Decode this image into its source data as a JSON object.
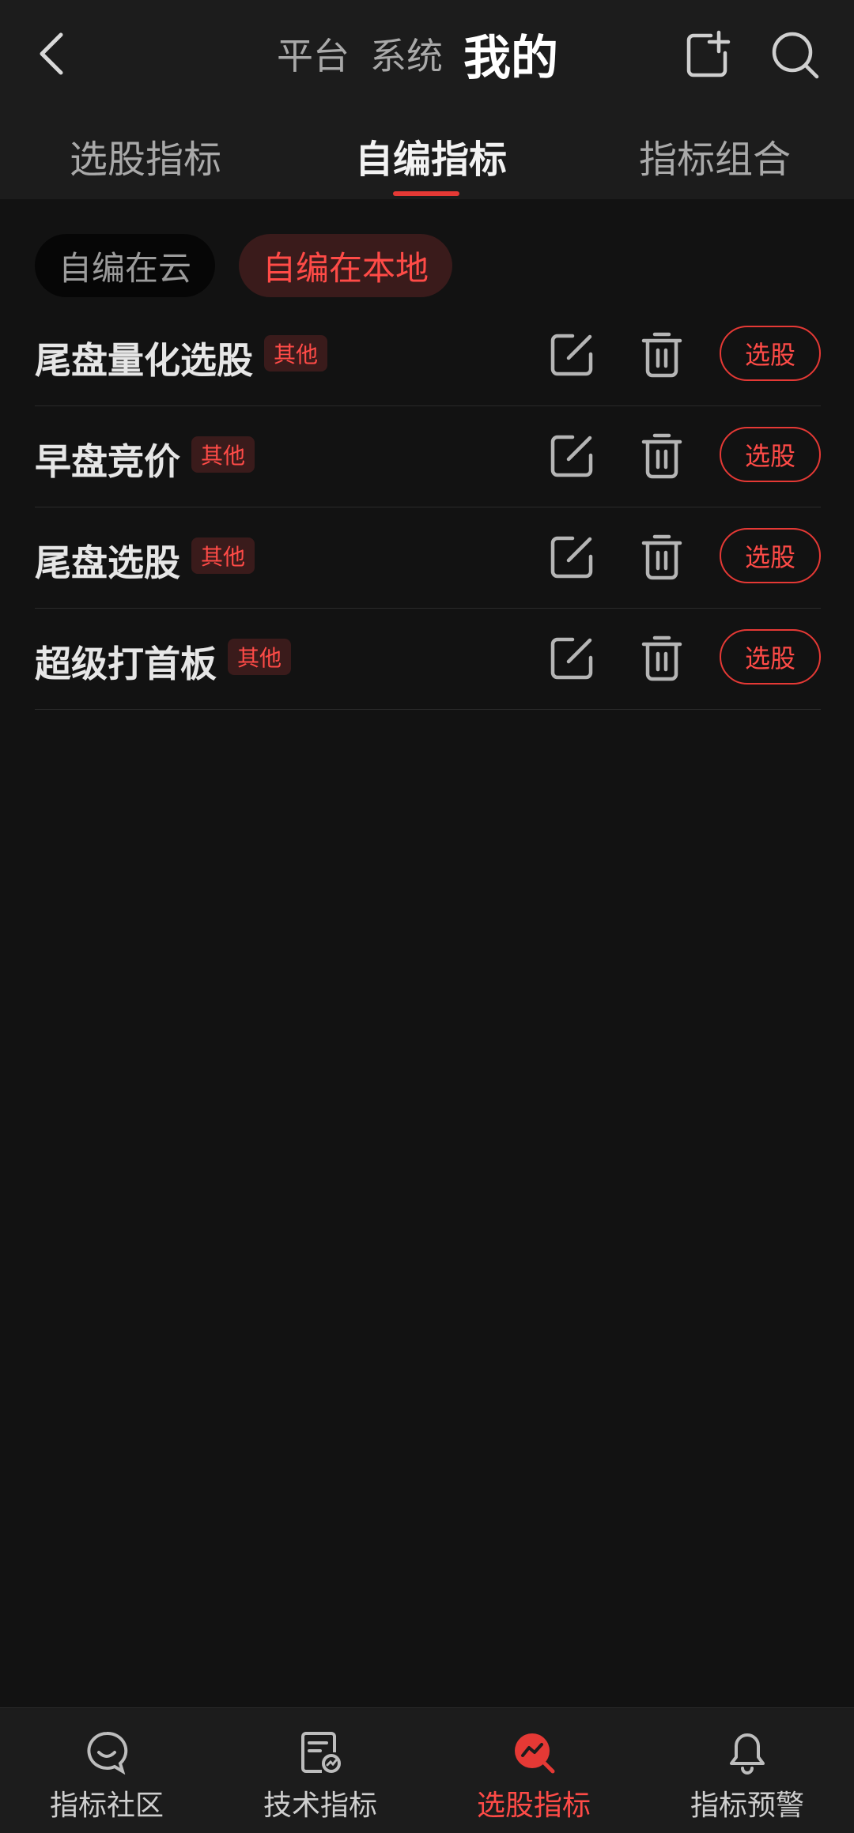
{
  "header": {
    "segments": [
      "平台",
      "系统",
      "我的"
    ],
    "active_segment": "我的"
  },
  "tabs": [
    {
      "label": "选股指标",
      "active": false
    },
    {
      "label": "自编指标",
      "active": true
    },
    {
      "label": "指标组合",
      "active": false
    }
  ],
  "chips": {
    "cloud": "自编在云",
    "local": "自编在本地"
  },
  "items": [
    {
      "name": "尾盘量化选股",
      "tag": "其他",
      "action": "选股"
    },
    {
      "name": "早盘竞价",
      "tag": "其他",
      "action": "选股"
    },
    {
      "name": "尾盘选股",
      "tag": "其他",
      "action": "选股"
    },
    {
      "name": "超级打首板",
      "tag": "其他",
      "action": "选股"
    }
  ],
  "bottom_nav": [
    {
      "label": "指标社区",
      "icon": "chat-bubble-icon"
    },
    {
      "label": "技术指标",
      "icon": "document-chart-icon"
    },
    {
      "label": "选股指标",
      "icon": "stock-search-icon"
    },
    {
      "label": "指标预警",
      "icon": "bell-icon"
    }
  ],
  "colors": {
    "accent": "#e53935",
    "background": "#121212",
    "header": "#1c1c1c"
  }
}
